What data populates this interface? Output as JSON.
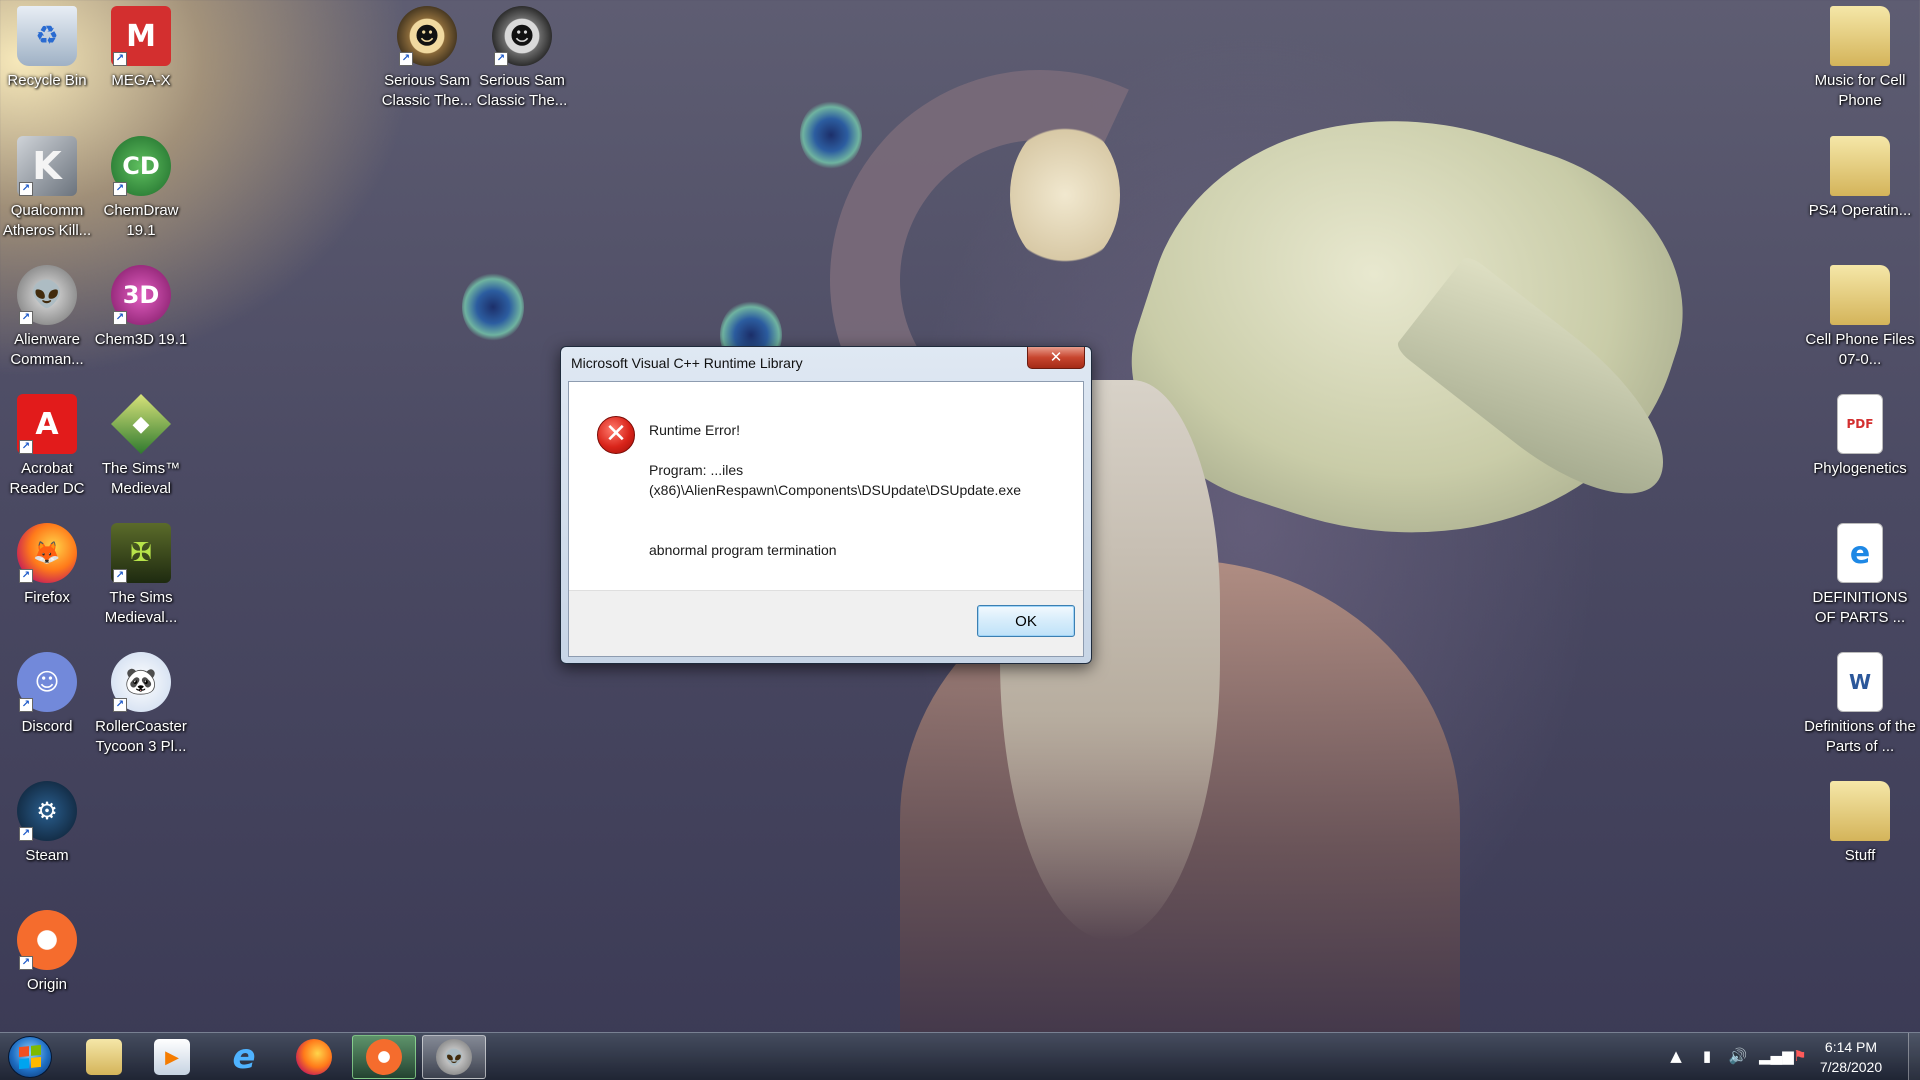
{
  "desktop": {
    "icons": [
      {
        "label": "Recycle Bin",
        "icon": "recycle-bin-icon"
      },
      {
        "label": "MEGA-X",
        "icon": "mega-x-icon"
      },
      {
        "label": "Qualcomm Atheros Kill...",
        "icon": "qualcomm-icon"
      },
      {
        "label": "ChemDraw 19.1",
        "icon": "chemdraw-icon"
      },
      {
        "label": "Alienware Comman...",
        "icon": "alienware-icon"
      },
      {
        "label": "Chem3D 19.1",
        "icon": "chem3d-icon"
      },
      {
        "label": "Acrobat Reader DC",
        "icon": "acrobat-icon"
      },
      {
        "label": "The Sims™ Medieval",
        "icon": "sims-medieval-icon"
      },
      {
        "label": "Firefox",
        "icon": "firefox-icon"
      },
      {
        "label": "The Sims Medieval...",
        "icon": "sims-medieval-pirates-icon"
      },
      {
        "label": "Discord",
        "icon": "discord-icon"
      },
      {
        "label": "RollerCoaster Tycoon 3 Pl...",
        "icon": "rollercoaster-icon"
      },
      {
        "label": "Steam",
        "icon": "steam-icon"
      },
      {
        "label": "Origin",
        "icon": "origin-icon"
      },
      {
        "label": "Serious Sam Classic The...",
        "icon": "serious-sam-icon"
      },
      {
        "label": "Serious Sam Classic The...",
        "icon": "serious-sam-icon"
      },
      {
        "label": "Music for Cell Phone",
        "icon": "folder-icon"
      },
      {
        "label": "PS4 Operatin...",
        "icon": "folder-icon"
      },
      {
        "label": "Cell Phone Files 07-0...",
        "icon": "folder-icon"
      },
      {
        "label": "Phylogenetics",
        "icon": "pdf-icon"
      },
      {
        "label": "DEFINITIONS OF PARTS ...",
        "icon": "internet-explorer-icon"
      },
      {
        "label": "Definitions of the Parts of ...",
        "icon": "word-document-icon"
      },
      {
        "label": "Stuff",
        "icon": "folder-icon"
      }
    ]
  },
  "dialog": {
    "title": "Microsoft Visual C++ Runtime Library",
    "close_label": "✕",
    "heading": "Runtime Error!",
    "program_line1": "Program: ...iles",
    "program_line2": "(x86)\\AlienRespawn\\Components\\DSUpdate\\DSUpdate.exe",
    "message": "abnormal program termination",
    "ok_label": "OK"
  },
  "taskbar": {
    "pinned": [
      {
        "name": "windows-explorer",
        "icon": "folder-icon"
      },
      {
        "name": "media-player",
        "icon": "media-player-icon"
      },
      {
        "name": "internet-explorer",
        "icon": "internet-explorer-icon"
      },
      {
        "name": "firefox",
        "icon": "firefox-icon"
      },
      {
        "name": "origin",
        "icon": "origin-icon"
      },
      {
        "name": "alienware",
        "icon": "alienware-icon"
      }
    ],
    "clock": {
      "time": "6:14 PM",
      "date": "7/28/2020"
    }
  },
  "colors": {
    "error_red": "#d9241a",
    "close_button": "#c7452e",
    "ok_border": "#3c7fb1"
  }
}
